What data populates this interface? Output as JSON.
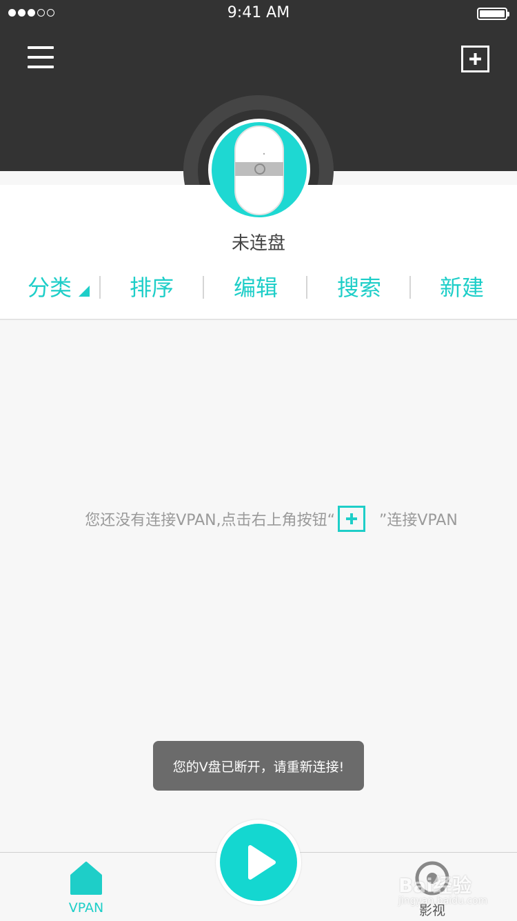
{
  "status_bar": {
    "time": "9:41 AM"
  },
  "header": {
    "menu_icon": "hamburger-icon",
    "add_icon": "plus-box-icon"
  },
  "device": {
    "name": "未连盘",
    "icon": "vdisk-device-icon",
    "accent": "#1ed8d2"
  },
  "toolbar": {
    "items": [
      {
        "label": "分类"
      },
      {
        "label": "排序"
      },
      {
        "label": "编辑"
      },
      {
        "label": "搜索"
      },
      {
        "label": "新建"
      }
    ],
    "accent": "#1ecec8"
  },
  "empty_state": {
    "text_before": "您还没有连接VPAN,点击右上角按钮“",
    "text_after": "”连接VPAN"
  },
  "toast": {
    "message": "您的V盘已断开，请重新连接!"
  },
  "tabbar": {
    "tabs": [
      {
        "label": "VPAN",
        "icon": "home-icon",
        "active": true
      },
      {
        "label": "影视",
        "icon": "video-icon",
        "active": false
      }
    ],
    "center_icon": "play-icon"
  },
  "watermark": {
    "text": "Bai经验",
    "sub": "jingyan.baidu.com"
  }
}
